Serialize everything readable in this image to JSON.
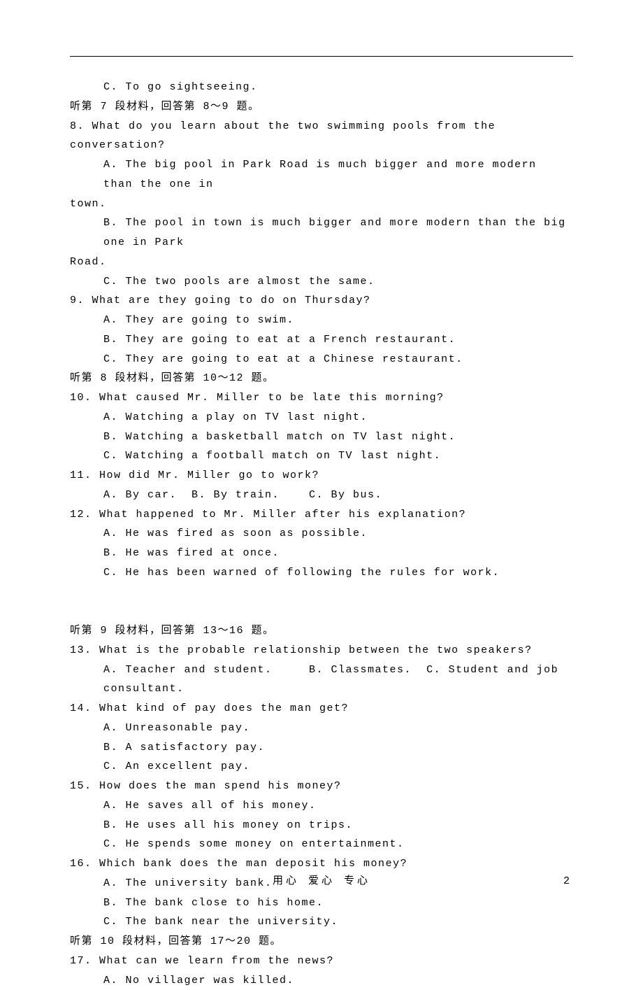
{
  "lines": [
    {
      "cls": "ind-opt",
      "text": "C. To go sightseeing."
    },
    {
      "cls": "ind-prompt",
      "text": "听第 7 段材料，回答第 8～9 题。"
    },
    {
      "cls": "ind-prompt",
      "text": "8. What do you learn about the two swimming pools from the conversation?"
    },
    {
      "cls": "ind-opt",
      "text": "A. The big pool in Park Road is much bigger and more modern than the one in"
    },
    {
      "cls": "ind-cont",
      "text": "town."
    },
    {
      "cls": "ind-opt",
      "text": "B. The pool in town is much bigger and more modern than the big one in Park"
    },
    {
      "cls": "ind-cont",
      "text": "Road."
    },
    {
      "cls": "ind-opt",
      "text": "C. The two pools are almost the same."
    },
    {
      "cls": "ind-prompt",
      "text": "9. What are they going to do on Thursday?"
    },
    {
      "cls": "ind-opt",
      "text": "A. They are going to swim."
    },
    {
      "cls": "ind-opt",
      "text": "B. They are going to eat at a French restaurant."
    },
    {
      "cls": "ind-opt",
      "text": "C. They are going to eat at a Chinese restaurant."
    },
    {
      "cls": "ind-prompt",
      "text": "听第 8 段材料，回答第 10～12 题。"
    },
    {
      "cls": "ind-prompt",
      "text": "10. What caused Mr. Miller to be late this morning?"
    },
    {
      "cls": "ind-opt",
      "text": "A. Watching a play on TV last night."
    },
    {
      "cls": "ind-opt",
      "text": "B. Watching a basketball match on TV last night."
    },
    {
      "cls": "ind-opt",
      "text": "C. Watching a football match on TV last night."
    },
    {
      "cls": "ind-prompt",
      "text": "11. How did Mr. Miller go to work?"
    },
    {
      "cls": "ind-opt",
      "text": "A. By car.  B. By train.    C. By bus."
    },
    {
      "cls": "ind-prompt",
      "text": "12. What happened to Mr. Miller after his explanation?"
    },
    {
      "cls": "ind-opt",
      "text": "A. He was fired as soon as possible."
    },
    {
      "cls": "ind-opt",
      "text": "B. He was fired at once."
    },
    {
      "cls": "ind-opt",
      "text": "C. He has been warned of following the rules for work."
    },
    {
      "cls": "gap2",
      "text": ""
    },
    {
      "cls": "ind-prompt",
      "text": "听第 9 段材料，回答第 13～16 题。"
    },
    {
      "cls": "ind-prompt",
      "text": "13. What is the probable relationship between the two speakers?"
    },
    {
      "cls": "ind-opt",
      "text": "A. Teacher and student.     B. Classmates.  C. Student and job consultant."
    },
    {
      "cls": "ind-prompt",
      "text": "14. What kind of pay does the man get?"
    },
    {
      "cls": "ind-opt",
      "text": "A. Unreasonable pay."
    },
    {
      "cls": "ind-opt",
      "text": "B. A satisfactory pay."
    },
    {
      "cls": "ind-opt",
      "text": "C. An excellent pay."
    },
    {
      "cls": "ind-prompt",
      "text": "15. How does the man spend his money?"
    },
    {
      "cls": "ind-opt",
      "text": "A. He saves all of his money."
    },
    {
      "cls": "ind-opt",
      "text": "B. He uses all his money on trips."
    },
    {
      "cls": "ind-opt",
      "text": "C. He spends some money on entertainment."
    },
    {
      "cls": "ind-prompt",
      "text": "16. Which bank does the man deposit his money?"
    },
    {
      "cls": "ind-opt",
      "text": "A. The university bank."
    },
    {
      "cls": "ind-opt",
      "text": "B. The bank close to his home."
    },
    {
      "cls": "ind-opt",
      "text": "C. The bank near the university."
    },
    {
      "cls": "ind-prompt",
      "text": "听第 10 段材料，回答第 17～20 题。"
    },
    {
      "cls": "ind-prompt",
      "text": "17. What can we learn from the news?"
    },
    {
      "cls": "ind-opt",
      "text": "A. No villager was killed."
    }
  ],
  "footer": {
    "text": "用心   爱心   专心",
    "page": "2"
  }
}
